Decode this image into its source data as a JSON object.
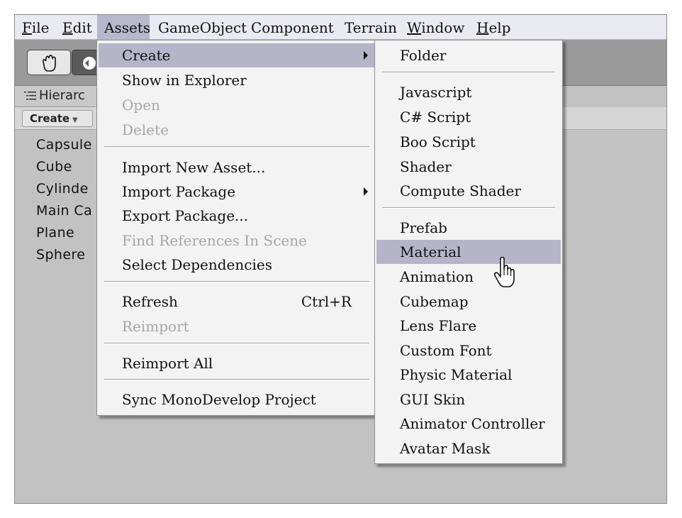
{
  "menubar": {
    "items": [
      {
        "label": "File",
        "underline": "F",
        "rest": "ile"
      },
      {
        "label": "Edit",
        "underline": "E",
        "rest": "dit"
      },
      {
        "label": "Assets",
        "underline": "",
        "rest": "Assets"
      },
      {
        "label": "GameObject",
        "underline": "",
        "rest": "GameObject"
      },
      {
        "label": "Component",
        "underline": "",
        "rest": "Component"
      },
      {
        "label": "Terrain",
        "underline": "",
        "rest": "Terrain"
      },
      {
        "label": "Window",
        "underline": "W",
        "rest": "indow"
      },
      {
        "label": "Help",
        "underline": "H",
        "rest": "elp"
      }
    ],
    "active": "Assets"
  },
  "hierarchy": {
    "tab_label": "Hierarc",
    "create_label": "Create",
    "items": [
      "Capsule",
      "Cube",
      "Cylinde",
      "Main Ca",
      "Plane",
      "Sphere"
    ]
  },
  "assets_menu": {
    "items": [
      {
        "label": "Create",
        "highlight": true,
        "submenu": true
      },
      {
        "label": "Show in Explorer"
      },
      {
        "label": "Open",
        "disabled": true
      },
      {
        "label": "Delete",
        "disabled": true
      },
      {
        "label": "Import New Asset..."
      },
      {
        "label": "Import Package",
        "submenu": true
      },
      {
        "label": "Export Package..."
      },
      {
        "label": "Find References In Scene",
        "disabled": true
      },
      {
        "label": "Select Dependencies"
      },
      {
        "label": "Refresh",
        "shortcut": "Ctrl+R"
      },
      {
        "label": "Reimport",
        "disabled": true
      },
      {
        "label": "Reimport All"
      },
      {
        "label": "Sync MonoDevelop Project"
      }
    ]
  },
  "create_submenu": {
    "items": [
      {
        "label": "Folder"
      },
      {
        "label": "Javascript"
      },
      {
        "label": "C# Script"
      },
      {
        "label": "Boo Script"
      },
      {
        "label": "Shader"
      },
      {
        "label": "Compute Shader"
      },
      {
        "label": "Prefab"
      },
      {
        "label": "Material",
        "highlight": true
      },
      {
        "label": "Animation"
      },
      {
        "label": "Cubemap"
      },
      {
        "label": "Lens Flare"
      },
      {
        "label": "Custom Font"
      },
      {
        "label": "Physic Material"
      },
      {
        "label": "GUI Skin"
      },
      {
        "label": "Animator Controller"
      },
      {
        "label": "Avatar Mask"
      }
    ]
  },
  "colors": {
    "menu_highlight": "#b6b4c8",
    "menubar_bg": "#eaeaf2",
    "disabled_text": "#a6a6a6"
  }
}
